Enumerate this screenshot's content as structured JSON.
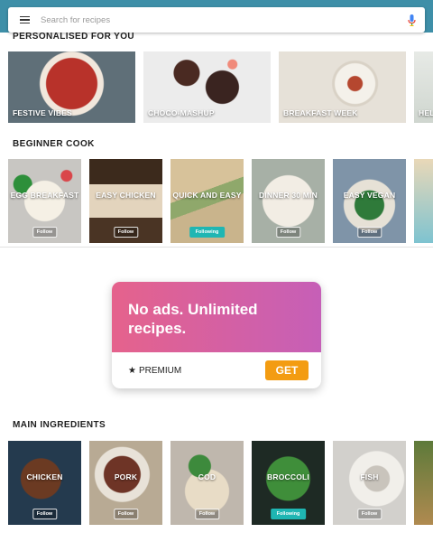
{
  "search": {
    "placeholder": "Search for recipes"
  },
  "sections": {
    "personalised": {
      "title": "PERSONALISED FOR YOU",
      "items": [
        {
          "label": "FESTIVE VIBES"
        },
        {
          "label": "CHOCO-MASHUP"
        },
        {
          "label": "BREAKFAST WEEK"
        },
        {
          "label": "HEL"
        }
      ]
    },
    "beginner": {
      "title": "BEGINNER COOK",
      "items": [
        {
          "label": "EGG BREAKFAST",
          "follow": "Follow"
        },
        {
          "label": "EASY CHICKEN",
          "follow": "Follow"
        },
        {
          "label": "QUICK AND EASY",
          "follow": "Following"
        },
        {
          "label": "DINNER 30 MIN",
          "follow": "Follow"
        },
        {
          "label": "EASY VEGAN",
          "follow": "Follow"
        }
      ]
    },
    "ingredients": {
      "title": "MAIN INGREDIENTS",
      "items": [
        {
          "label": "CHICKEN",
          "follow": "Follow"
        },
        {
          "label": "PORK",
          "follow": "Follow"
        },
        {
          "label": "COD",
          "follow": "Follow"
        },
        {
          "label": "BROCCOLI",
          "follow": "Following"
        },
        {
          "label": "FISH",
          "follow": "Follow"
        }
      ]
    }
  },
  "promo": {
    "headline": "No ads. Unlimited recipes.",
    "premium_label": "PREMIUM",
    "star": "★",
    "cta": "GET"
  },
  "colors": {
    "header": "#3e8fa8",
    "following": "#1fb6b3",
    "cta": "#f39c12",
    "promo_start": "#e5628c",
    "promo_end": "#c65fb7"
  }
}
